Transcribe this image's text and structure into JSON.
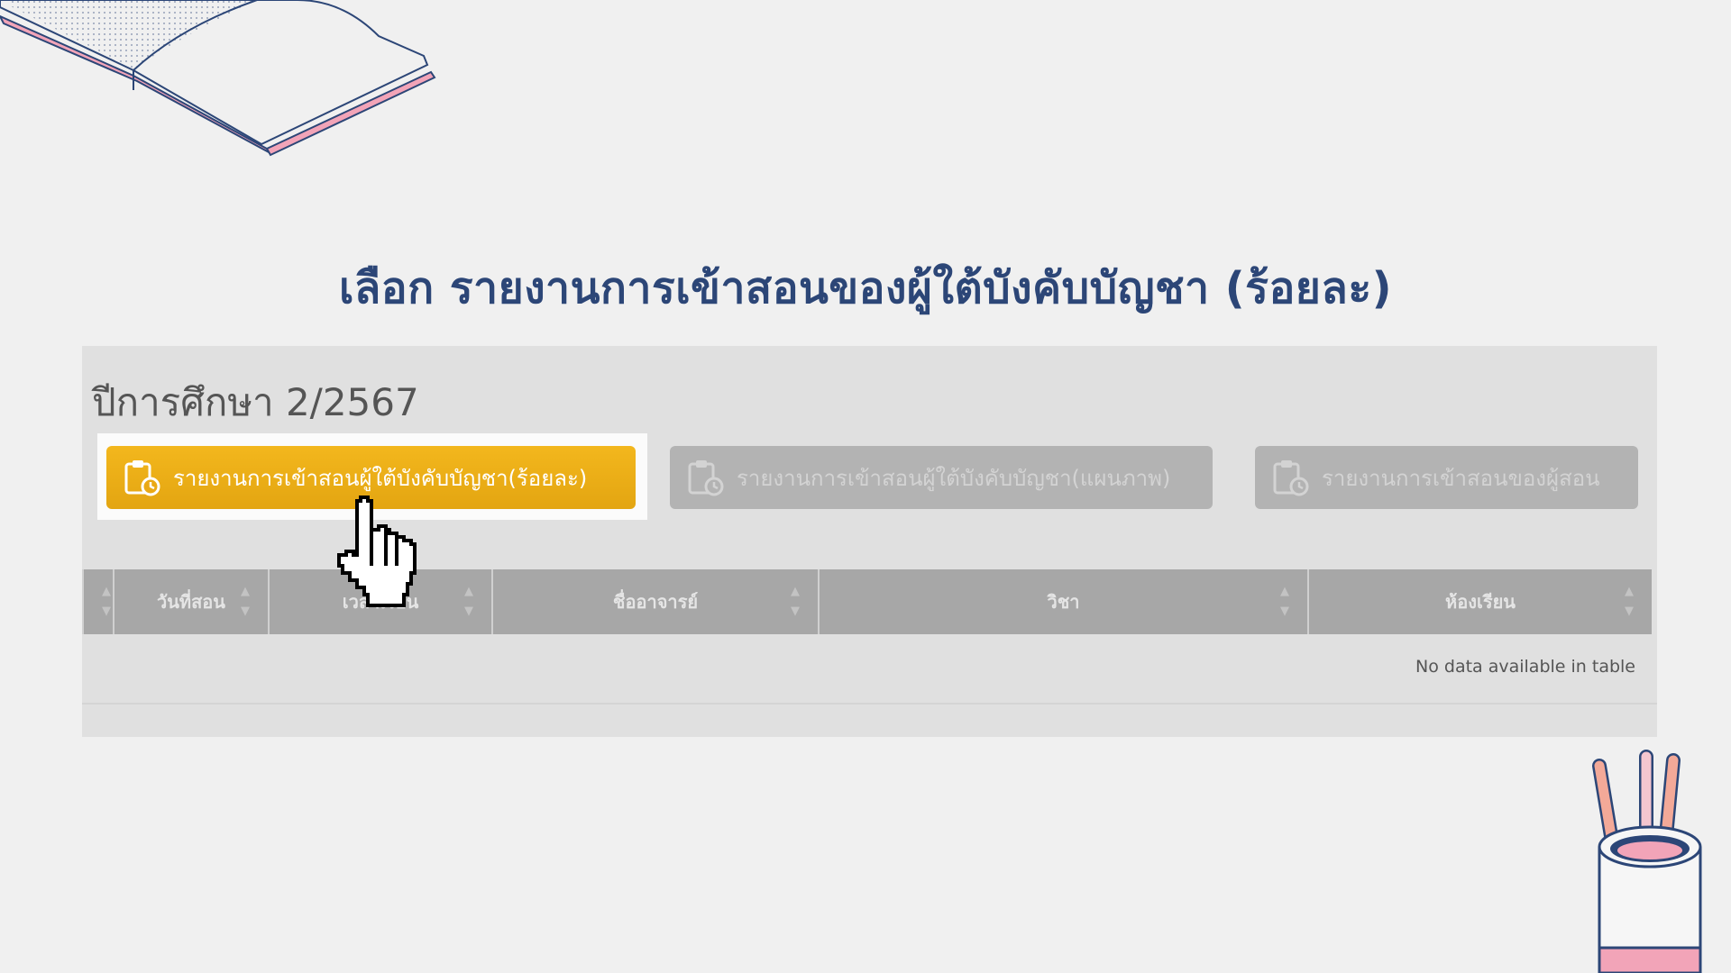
{
  "headline": "เลือก รายงานการเข้าสอนของผู้ใต้บังคับบัญชา (ร้อยละ)",
  "academic_year_title": "ปีการศึกษา 2/2567",
  "buttons": [
    {
      "label": "รายงานการเข้าสอนผู้ใต้บังคับบัญชา(ร้อยละ)",
      "icon": "clipboard-clock-icon",
      "state": "highlighted"
    },
    {
      "label": "รายงานการเข้าสอนผู้ใต้บังคับบัญชา(แผนภาพ)",
      "icon": "clipboard-clock-icon",
      "state": "dimmed"
    },
    {
      "label": "รายงานการเข้าสอนของผู้สอน",
      "icon": "clipboard-clock-icon",
      "state": "dimmed"
    }
  ],
  "table": {
    "columns": [
      "วันที่สอน",
      "เวลาเรียน",
      "ชื่ออาจารย์",
      "วิชา",
      "ห้องเรียน"
    ],
    "empty_message": "No data available in table"
  },
  "colors": {
    "headline": "#2c4677",
    "primary_button": "#eaa915",
    "background": "#f0f0f0",
    "overlay": "#e0e0e0"
  },
  "decorations": [
    "open-book-illustration",
    "pencil-cup-illustration",
    "hand-pointer-cursor"
  ]
}
